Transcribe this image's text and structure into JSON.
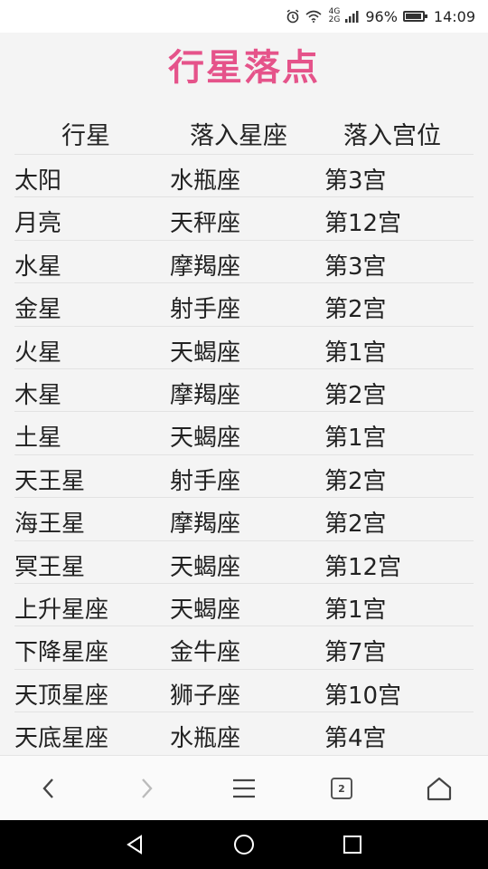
{
  "status_bar": {
    "network_top": "4G",
    "network_bottom": "2G",
    "battery": "96%",
    "time": "14:09"
  },
  "page": {
    "title": "行星落点"
  },
  "table": {
    "headers": [
      "行星",
      "落入星座",
      "落入宫位"
    ],
    "rows": [
      [
        "太阳",
        "水瓶座",
        "第3宫"
      ],
      [
        "月亮",
        "天秤座",
        "第12宫"
      ],
      [
        "水星",
        "摩羯座",
        "第3宫"
      ],
      [
        "金星",
        "射手座",
        "第2宫"
      ],
      [
        "火星",
        "天蝎座",
        "第1宫"
      ],
      [
        "木星",
        "摩羯座",
        "第2宫"
      ],
      [
        "土星",
        "天蝎座",
        "第1宫"
      ],
      [
        "天王星",
        "射手座",
        "第2宫"
      ],
      [
        "海王星",
        "摩羯座",
        "第2宫"
      ],
      [
        "冥王星",
        "天蝎座",
        "第12宫"
      ],
      [
        "上升星座",
        "天蝎座",
        "第1宫"
      ],
      [
        "下降星座",
        "金牛座",
        "第7宫"
      ],
      [
        "天顶星座",
        "狮子座",
        "第10宫"
      ],
      [
        "天底星座",
        "水瓶座",
        "第4宫"
      ]
    ]
  },
  "toolbar": {
    "tab_count": "2",
    "icons": [
      "back-icon",
      "forward-icon",
      "menu-icon",
      "tabs-icon",
      "home-icon"
    ]
  },
  "colors": {
    "title": "#e5538a",
    "background": "#f4f4f4"
  }
}
